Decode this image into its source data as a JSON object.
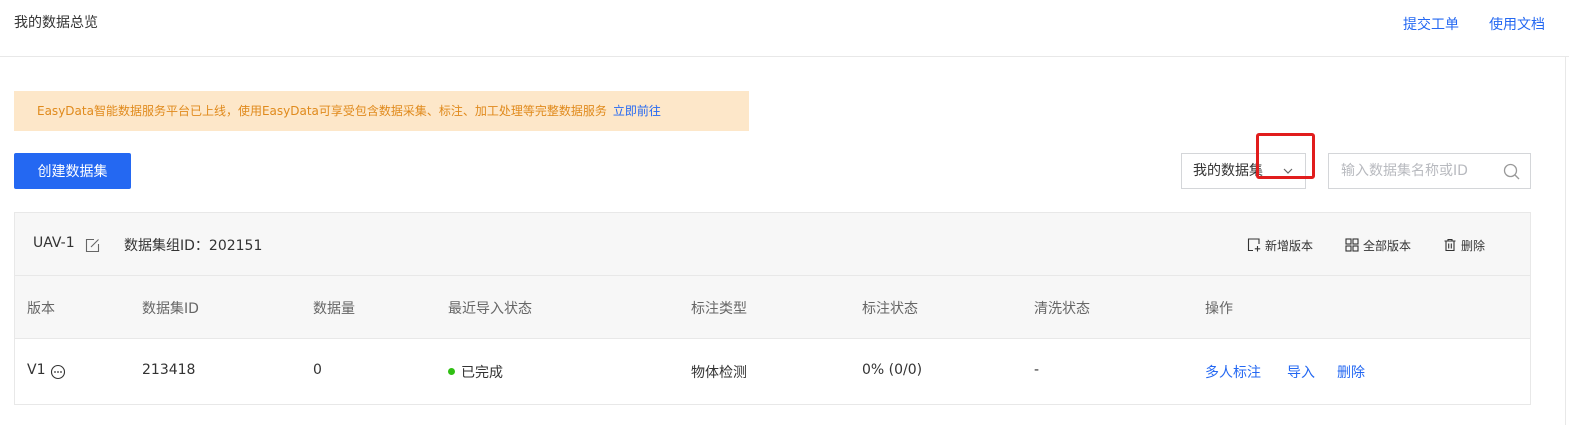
{
  "header": {
    "title": "我的数据总览",
    "links": [
      "提交工单",
      "使用文档"
    ]
  },
  "notice": {
    "text": "EasyData智能数据服务平台已上线，使用EasyData可享受包含数据采集、标注、加工处理等完整数据服务",
    "link": "立即前往"
  },
  "toolbar": {
    "create_label": "创建数据集",
    "filter_value": "我的数据集",
    "search_placeholder": "输入数据集名称或ID"
  },
  "dataset_group": {
    "name": "UAV-1",
    "group_id_label": "数据集组ID：202151",
    "actions": [
      "新增版本",
      "全部版本",
      "删除"
    ]
  },
  "table": {
    "columns": [
      "版本",
      "数据集ID",
      "数据量",
      "最近导入状态",
      "标注类型",
      "标注状态",
      "清洗状态",
      "操作"
    ],
    "rows": [
      {
        "version": "V1",
        "dataset_id": "213418",
        "count": "0",
        "import_status": "已完成",
        "label_type": "物体检测",
        "label_status": "0% (0/0)",
        "clean_status": "-",
        "ops": [
          "多人标注",
          "导入",
          "删除"
        ]
      }
    ]
  },
  "colors": {
    "accent": "#2468f2",
    "notice_bg": "#fde7c9",
    "notice_text": "#e08a1c",
    "success": "#30bf13",
    "highlight": "#e11d1d"
  },
  "icons": [
    "edit-icon",
    "add-version-icon",
    "grid-icon",
    "trash-icon",
    "more-icon",
    "chevron-down-icon",
    "search-icon"
  ]
}
